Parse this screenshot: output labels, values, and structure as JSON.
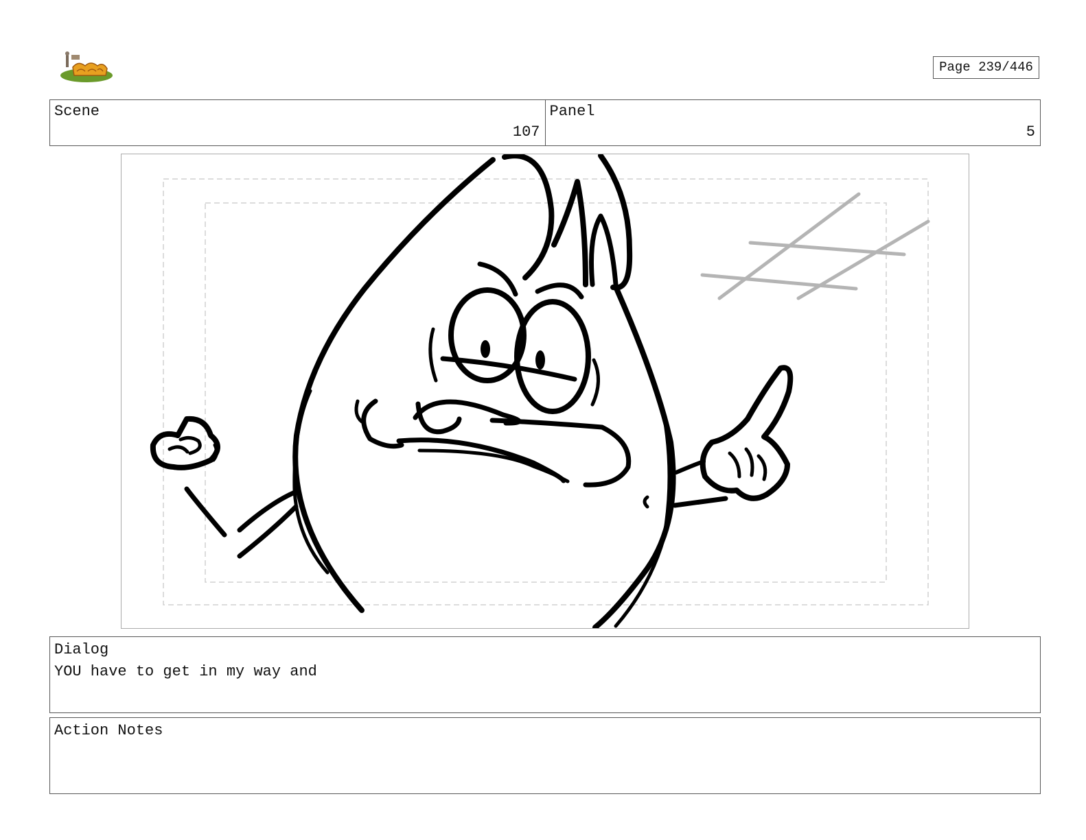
{
  "header": {
    "page_indicator": "Page 239/446"
  },
  "scene": {
    "label": "Scene",
    "value": "107"
  },
  "panel": {
    "label": "Panel",
    "value": "5"
  },
  "dialog": {
    "label": "Dialog",
    "text": "YOU have to get in my way and"
  },
  "action_notes": {
    "label": "Action Notes",
    "text": ""
  },
  "colors": {
    "logo_grass": "#6a9a2a",
    "logo_letters": "#e8a020",
    "sketch_ink": "#000000",
    "sketch_gray": "#b4b4b4",
    "safe_frame": "#d0d0d0"
  }
}
